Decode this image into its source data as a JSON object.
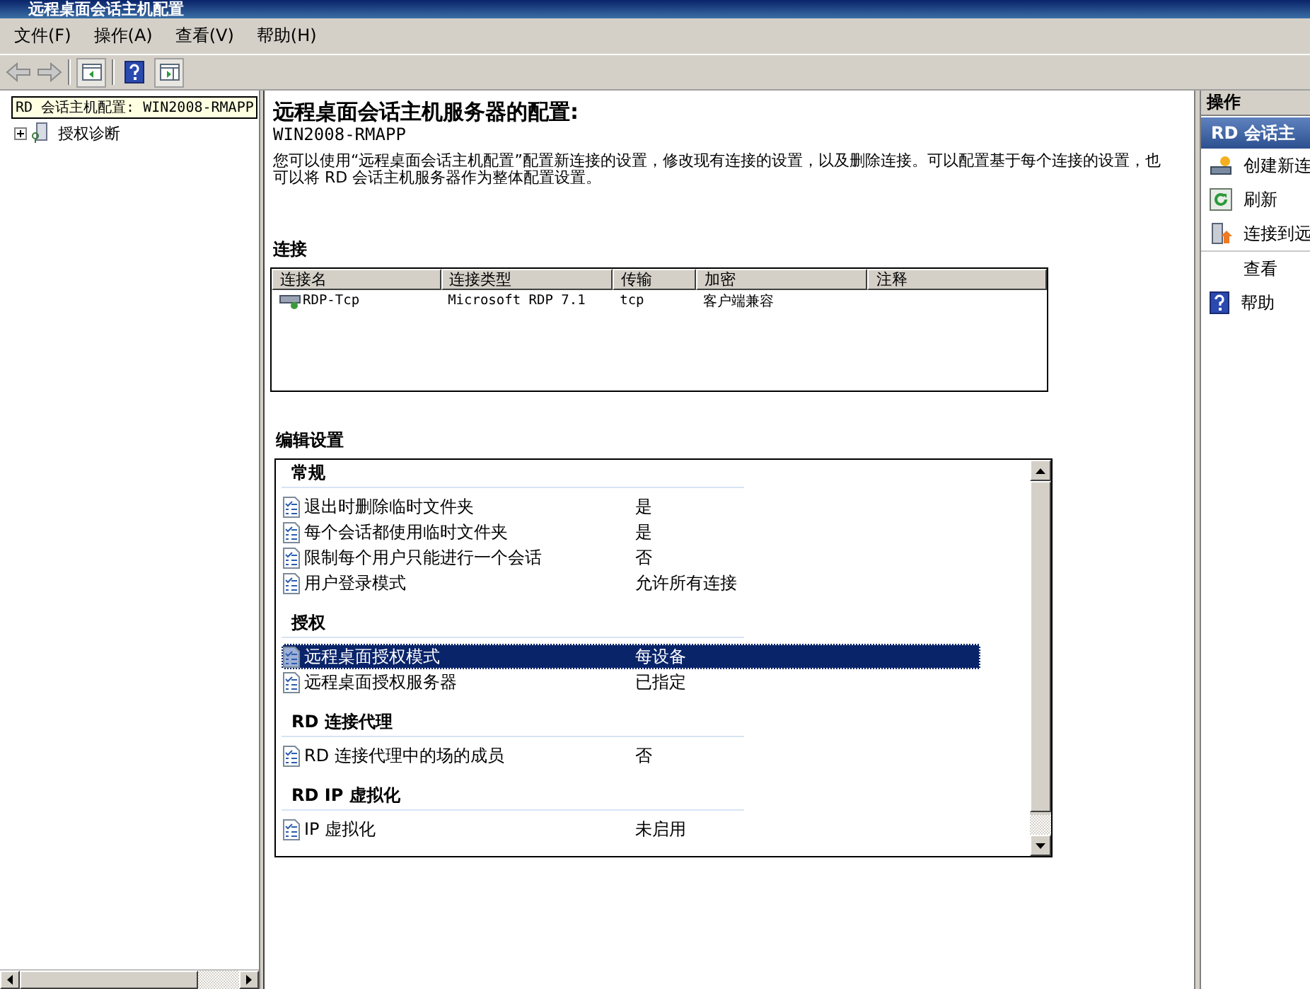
{
  "window": {
    "title": "远程桌面会话主机配置"
  },
  "menu": [
    {
      "label": "文件(F)"
    },
    {
      "label": "操作(A)"
    },
    {
      "label": "查看(V)"
    },
    {
      "label": "帮助(H)"
    }
  ],
  "tree": {
    "items": [
      {
        "label": "RD 会话主机配置: WIN2008-RMAPP",
        "selected": true,
        "children": [
          {
            "label": "授权诊断",
            "selected": false,
            "expanded": false
          }
        ]
      }
    ]
  },
  "content": {
    "title": "远程桌面会话主机服务器的配置:",
    "server": "WIN2008-RMAPP",
    "description": "您可以使用“远程桌面会话主机配置”配置新连接的设置，修改现有连接的设置，以及删除连接。可以配置基于每个连接的设置，也可以将 RD 会话主机服务器作为整体配置设置。",
    "connections": {
      "label": "连接",
      "columns": [
        "连接名",
        "连接类型",
        "传输",
        "加密",
        "注释"
      ],
      "rows": [
        {
          "selected": false,
          "cells": [
            "RDP-Tcp",
            "Microsoft RDP 7.1",
            "tcp",
            "客户端兼容",
            ""
          ]
        }
      ]
    },
    "edit_settings": {
      "label": "编辑设置",
      "groups": [
        {
          "title": "常规",
          "items": [
            {
              "name": "退出时删除临时文件夹",
              "value": "是",
              "selected": false
            },
            {
              "name": "每个会话都使用临时文件夹",
              "value": "是",
              "selected": false
            },
            {
              "name": "限制每个用户只能进行一个会话",
              "value": "否",
              "selected": false
            },
            {
              "name": "用户登录模式",
              "value": "允许所有连接",
              "selected": false
            }
          ]
        },
        {
          "title": "授权",
          "items": [
            {
              "name": "远程桌面授权模式",
              "value": "每设备",
              "selected": true
            },
            {
              "name": "远程桌面授权服务器",
              "value": "已指定",
              "selected": false
            }
          ]
        },
        {
          "title": "RD 连接代理",
          "items": [
            {
              "name": "RD 连接代理中的场的成员",
              "value": "否",
              "selected": false
            }
          ]
        },
        {
          "title": "RD IP 虚拟化",
          "items": [
            {
              "name": "IP 虚拟化",
              "value": "未启用",
              "selected": false
            }
          ]
        }
      ]
    }
  },
  "actions": {
    "title": "操作",
    "group": "RD 会话主",
    "items": [
      {
        "label": "创建新连",
        "kind": "new"
      },
      {
        "label": "刷新",
        "kind": "refresh"
      },
      {
        "label": "连接到远",
        "kind": "connect"
      },
      {
        "label": "查看",
        "kind": "plain"
      },
      {
        "label": "帮助",
        "kind": "help"
      }
    ]
  }
}
